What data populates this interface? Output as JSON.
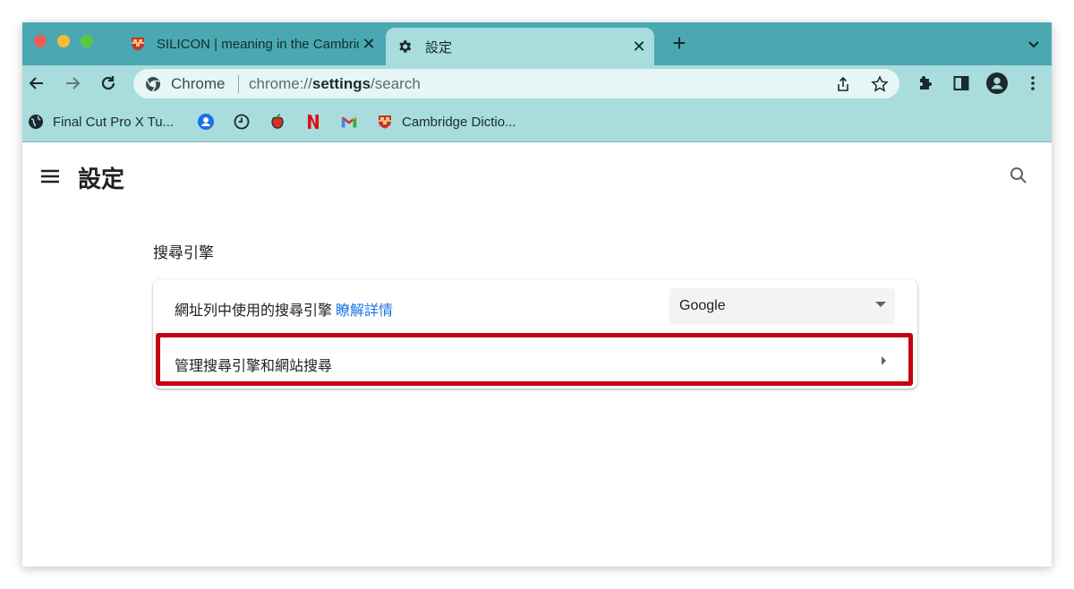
{
  "tabs": [
    {
      "title": "SILICON | meaning in the Cambridge English Dictionary",
      "icon": "cambridge-shield-icon",
      "active": false
    },
    {
      "title": "設定",
      "icon": "gear-icon",
      "active": true
    }
  ],
  "toolbar": {
    "omnibox_chip": "Chrome",
    "url_prefix": "chrome://",
    "url_host": "settings",
    "url_path": "/search"
  },
  "bookmarks": [
    {
      "label": "Final Cut Pro X Tu...",
      "icon": "globe-icon"
    },
    {
      "label": "",
      "icon": "user-circle-icon"
    },
    {
      "label": "",
      "icon": "clock-icon"
    },
    {
      "label": "",
      "icon": "apple-icon"
    },
    {
      "label": "",
      "icon": "netflix-icon"
    },
    {
      "label": "",
      "icon": "gmail-icon"
    },
    {
      "label": "Cambridge Dictio...",
      "icon": "cambridge-shield-icon"
    }
  ],
  "page": {
    "title": "設定",
    "section_title": "搜尋引擎",
    "row1_label": "網址列中使用的搜尋引擎",
    "row1_link": "瞭解詳情",
    "select_value": "Google",
    "row2_label": "管理搜尋引擎和網站搜尋"
  },
  "colors": {
    "tab_strip": "#4aa8b2",
    "toolbar": "#a9dcdc",
    "link": "#1a73e8",
    "highlight": "#c5000f"
  }
}
